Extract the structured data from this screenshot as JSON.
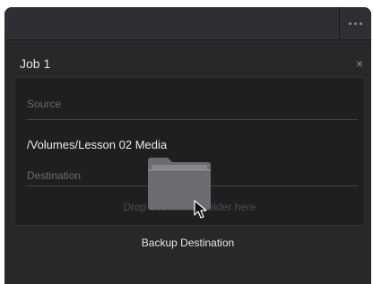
{
  "panel": {
    "menu_icon": "more-options-icon",
    "job_title": "Job 1",
    "close_icon": "close-icon",
    "source_label": "Source",
    "source_value": "/Volumes/Lesson 02 Media",
    "destination_label": "Destination",
    "drop_hint": "Drop destination folder here",
    "caption": "Backup Destination"
  },
  "colors": {
    "panel_bg": "#28282b",
    "card_bg": "#1f1f22",
    "text": "#e3e3e3",
    "muted": "#6b6b70"
  }
}
